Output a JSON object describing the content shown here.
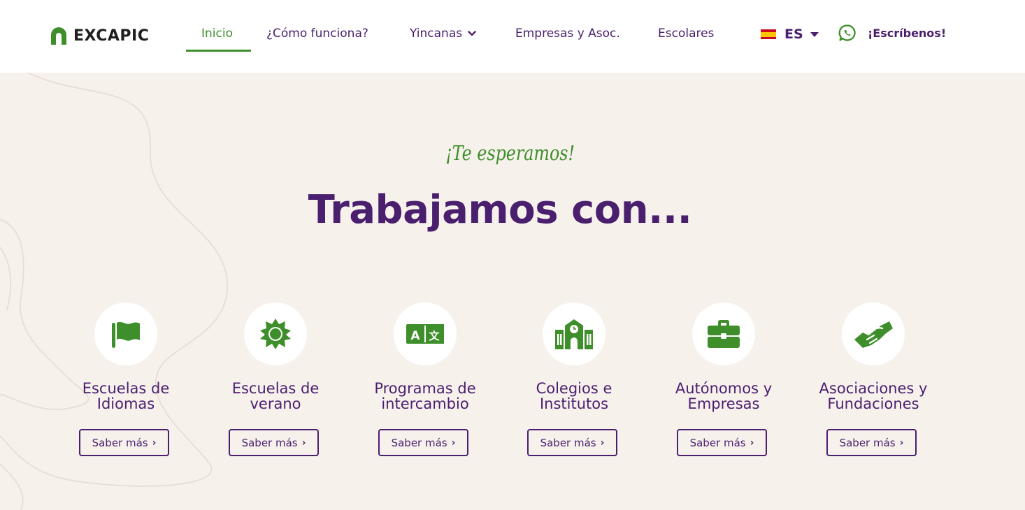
{
  "header": {
    "logo_text": "EXCAPIC",
    "nav": [
      {
        "label": "Inicio",
        "active": true
      },
      {
        "label": "¿Cómo funciona?"
      },
      {
        "label": "Yincanas",
        "has_dropdown": true
      },
      {
        "label": "Empresas y Asoc."
      },
      {
        "label": "Escolares"
      }
    ],
    "language": {
      "label": "ES",
      "flag": "spain-flag-icon"
    },
    "contact_label": "¡Escríbenos!"
  },
  "main": {
    "kicker": "¡Te esperamos!",
    "headline": "Trabajamos con...",
    "cards": [
      {
        "icon": "flag-icon",
        "title_line1": "Escuelas de",
        "title_line2": "Idiomas",
        "button": "Saber más"
      },
      {
        "icon": "sun-icon",
        "title_line1": "Escuelas de",
        "title_line2": "verano",
        "button": "Saber más"
      },
      {
        "icon": "translate-icon",
        "title_line1": "Programas de",
        "title_line2": "intercambio",
        "button": "Saber más"
      },
      {
        "icon": "school-icon",
        "title_line1": "Colegios e",
        "title_line2": "Institutos",
        "button": "Saber más"
      },
      {
        "icon": "briefcase-icon",
        "title_line1": "Autónomos y",
        "title_line2": "Empresas",
        "button": "Saber más"
      },
      {
        "icon": "handshake-icon",
        "title_line1": "Asociaciones y",
        "title_line2": "Fundaciones",
        "button": "Saber más"
      }
    ]
  },
  "colors": {
    "brand_purple": "#4a1f6e",
    "brand_green": "#3e8e2b",
    "background": "#f7f1ec"
  }
}
